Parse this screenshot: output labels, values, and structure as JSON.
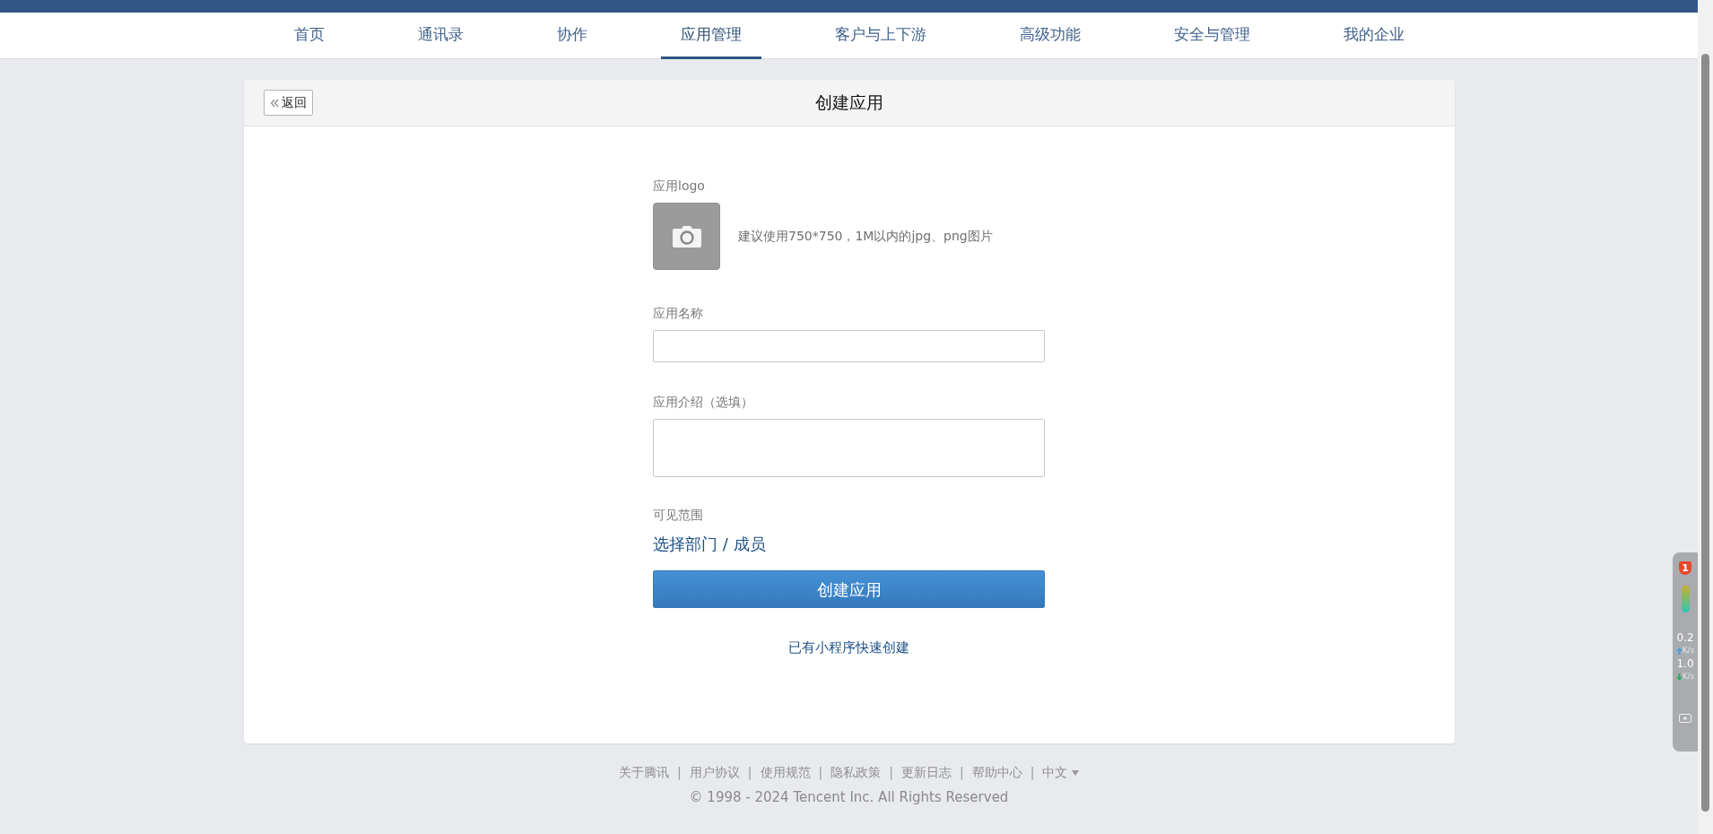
{
  "nav": {
    "tabs": [
      {
        "label": "首页",
        "selected": false
      },
      {
        "label": "通讯录",
        "selected": false
      },
      {
        "label": "协作",
        "selected": false
      },
      {
        "label": "应用管理",
        "selected": true
      },
      {
        "label": "客户与上下游",
        "selected": false
      },
      {
        "label": "高级功能",
        "selected": false
      },
      {
        "label": "安全与管理",
        "selected": false
      },
      {
        "label": "我的企业",
        "selected": false
      }
    ]
  },
  "panel": {
    "back_button": "返回",
    "title": "创建应用"
  },
  "form": {
    "logo": {
      "label": "应用logo",
      "hint": "建议使用750*750，1M以内的jpg、png图片"
    },
    "name": {
      "label": "应用名称"
    },
    "description": {
      "label": "应用介绍（选填）"
    },
    "visibility": {
      "label": "可见范围",
      "link": "选择部门 / 成员"
    },
    "submit": "创建应用",
    "quick_create": "已有小程序快速创建"
  },
  "footer": {
    "links": [
      "关于腾讯",
      "用户协议",
      "使用规范",
      "隐私政策",
      "更新日志",
      "帮助中心"
    ],
    "separator": "|",
    "language": "中文",
    "copyright": "© 1998 - 2024 Tencent Inc. All Rights Reserved"
  },
  "speed_widget": {
    "badge": "1",
    "upload": {
      "value": "0.2",
      "unit": "K/s"
    },
    "download": {
      "value": "1.0",
      "unit": "K/s"
    }
  }
}
